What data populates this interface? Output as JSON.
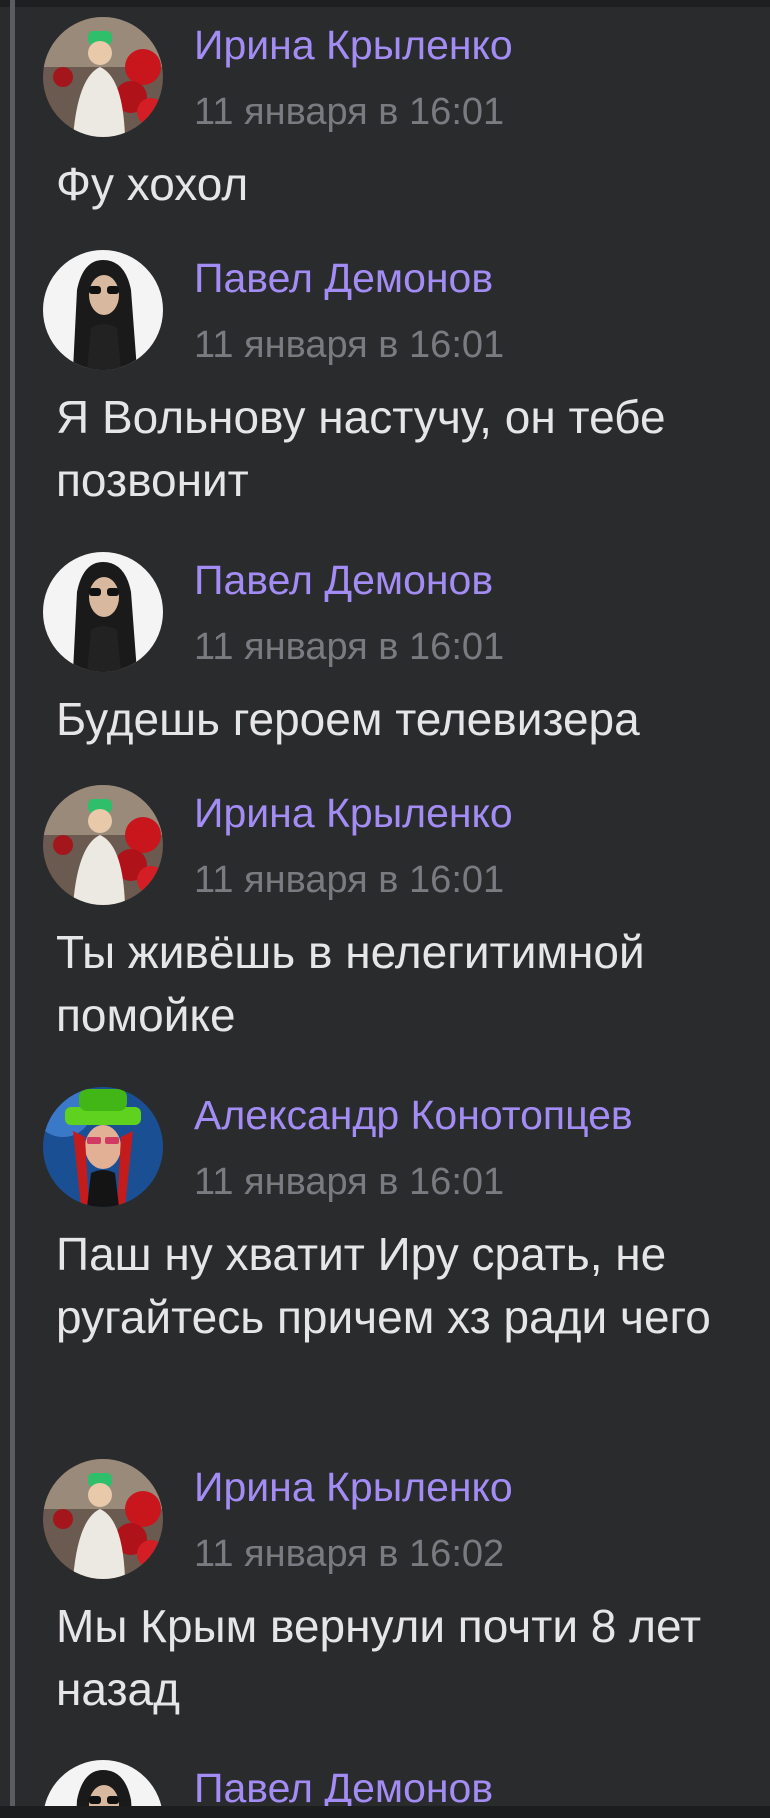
{
  "comments": [
    {
      "author": "Ирина Крыленко",
      "date": "11 января в 16:01",
      "text": "Фу хохол",
      "avatar": "irina-avatar"
    },
    {
      "author": "Павел Демонов",
      "date": "11 января в 16:01",
      "text": "Я Вольнову настучу, он тебе позвонит",
      "avatar": "pavel-avatar"
    },
    {
      "author": "Павел Демонов",
      "date": "11 января в 16:01",
      "text": "Будешь героем телевизера",
      "avatar": "pavel-avatar"
    },
    {
      "author": "Ирина Крыленко",
      "date": "11 января в 16:01",
      "text": "Ты живёшь в нелегитимной помойке",
      "avatar": "irina-avatar"
    },
    {
      "author": "Александр Конотопцев",
      "date": "11 января в 16:01",
      "text": "Паш ну хватит Иру срать, не ругайтесь причем хз ради чего",
      "avatar": "alexander-avatar"
    },
    {
      "author": "Ирина Крыленко",
      "date": "11 января в 16:02",
      "text": "Мы Крым вернули почти 8 лет назад",
      "avatar": "irina-avatar"
    },
    {
      "author": "Павел Демонов",
      "date": "",
      "text": "",
      "avatar": "pavel-avatar"
    }
  ],
  "colors": {
    "background": "#2a2b2d",
    "author": "#a48cf5",
    "date": "#7a7b80",
    "text": "#e6e6e8"
  }
}
